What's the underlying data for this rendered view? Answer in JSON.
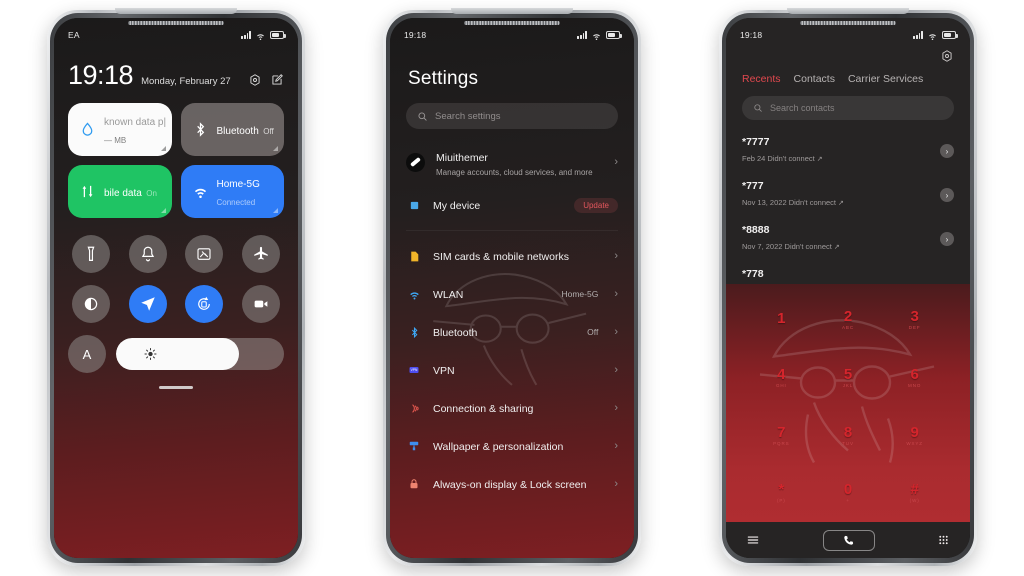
{
  "phone1": {
    "status": {
      "label": "EA",
      "icons": [
        "signal-icon",
        "wifi-icon",
        "battery-icon"
      ]
    },
    "clock": "19:18",
    "date": "Monday, February 27",
    "header_icons": [
      "settings-gear-icon",
      "edit-icon"
    ],
    "tiles": [
      {
        "name": "known data p|",
        "sub": "— MB",
        "style": "light",
        "icon": "data-drop-icon"
      },
      {
        "name": "Bluetooth",
        "sub": "Off",
        "style": "grey",
        "icon": "bluetooth-icon"
      },
      {
        "name": "bile data",
        "sub": "On",
        "style": "green",
        "icon": "mobile-data-icon"
      },
      {
        "name": "Home-5G",
        "sub": "Connected",
        "style": "blue",
        "icon": "wifi-icon"
      }
    ],
    "toggles": [
      {
        "icon": "flashlight-icon",
        "on": false
      },
      {
        "icon": "bell-icon",
        "on": false
      },
      {
        "icon": "screenshot-icon",
        "on": false
      },
      {
        "icon": "airplane-icon",
        "on": false
      },
      {
        "icon": "dark-mode-icon",
        "on": false
      },
      {
        "icon": "location-icon",
        "on": true
      },
      {
        "icon": "auto-rotate-icon",
        "on": true
      },
      {
        "icon": "screen-recorder-icon",
        "on": false
      }
    ],
    "auto_brightness_label": "A",
    "brightness_percent": 73
  },
  "phone2": {
    "status": {
      "time": "19:18"
    },
    "title": "Settings",
    "search_placeholder": "Search settings",
    "account": {
      "name": "Miuithemer",
      "desc": "Manage accounts, cloud services, and more",
      "icon": "account-avatar"
    },
    "my_device": {
      "label": "My device",
      "badge": "Update",
      "icon": "device-icon"
    },
    "items": [
      {
        "label": "SIM cards & mobile networks",
        "value": "",
        "icon": "sim-card-icon"
      },
      {
        "label": "WLAN",
        "value": "Home-5G",
        "icon": "wifi-icon"
      },
      {
        "label": "Bluetooth",
        "value": "Off",
        "icon": "bluetooth-icon"
      },
      {
        "label": "VPN",
        "value": "",
        "icon": "vpn-icon"
      },
      {
        "label": "Connection & sharing",
        "value": "",
        "icon": "connection-sharing-icon"
      },
      {
        "label": "Wallpaper & personalization",
        "value": "",
        "icon": "wallpaper-icon"
      },
      {
        "label": "Always-on display & Lock screen",
        "value": "",
        "icon": "lock-icon"
      }
    ]
  },
  "phone3": {
    "status": {
      "time": "19:18"
    },
    "gear_icon": "settings-gear-icon",
    "tabs": [
      {
        "label": "Recents",
        "active": true
      },
      {
        "label": "Contacts",
        "active": false
      },
      {
        "label": "Carrier Services",
        "active": false
      }
    ],
    "search_placeholder": "Search contacts",
    "calls": [
      {
        "number": "*7777",
        "meta": "Feb 24 Didn't connect"
      },
      {
        "number": "*777",
        "meta": "Nov 13, 2022 Didn't connect"
      },
      {
        "number": "*8888",
        "meta": "Nov 7, 2022 Didn't connect"
      },
      {
        "number": "*778",
        "meta": ""
      }
    ],
    "keys": [
      {
        "digit": "1",
        "letters": ""
      },
      {
        "digit": "2",
        "letters": "ABC"
      },
      {
        "digit": "3",
        "letters": "DEF"
      },
      {
        "digit": "4",
        "letters": "GHI"
      },
      {
        "digit": "5",
        "letters": "JKL"
      },
      {
        "digit": "6",
        "letters": "MNO"
      },
      {
        "digit": "7",
        "letters": "PQRS"
      },
      {
        "digit": "8",
        "letters": "TUV"
      },
      {
        "digit": "9",
        "letters": "WXYZ"
      },
      {
        "digit": "*",
        "letters": "(P)"
      },
      {
        "digit": "0",
        "letters": "+"
      },
      {
        "digit": "#",
        "letters": "(W)"
      }
    ],
    "bottom": [
      {
        "icon": "menu-icon"
      },
      {
        "icon": "call-icon"
      },
      {
        "icon": "keypad-icon"
      }
    ]
  },
  "colors": {
    "accent_blue": "#2f7cf6",
    "accent_green": "#1fc464",
    "accent_red": "#e0484e",
    "key_red": "#d5252c"
  }
}
